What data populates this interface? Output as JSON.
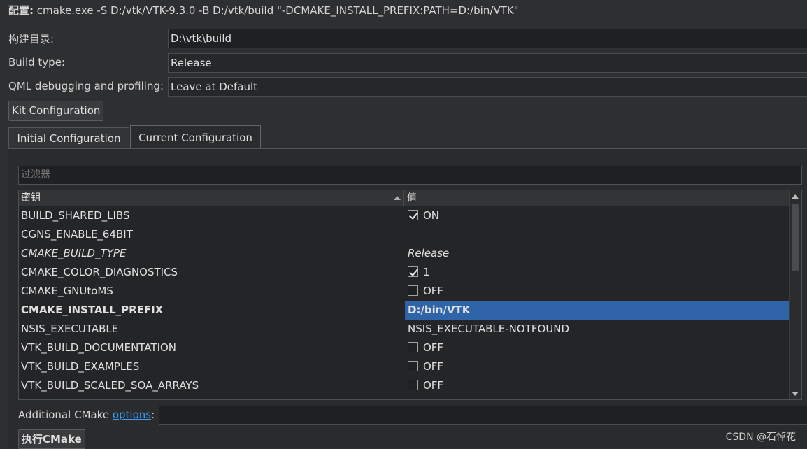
{
  "header": {
    "prefix": "配置:",
    "command": " cmake.exe -S D:/vtk/VTK-9.3.0 -B D:/vtk/build \"-DCMAKE_INSTALL_PREFIX:PATH=D:/bin/VTK\""
  },
  "form": {
    "build_dir_label": "构建目录:",
    "build_dir_value": "D:\\vtk\\build",
    "build_type_label": "Build type:",
    "build_type_value": "Release",
    "qml_label": "QML debugging and profiling:",
    "qml_value": "Leave at Default"
  },
  "kit_button": "Kit Configuration",
  "tabs": [
    {
      "label": "Initial Configuration",
      "active": false
    },
    {
      "label": "Current Configuration",
      "active": true
    }
  ],
  "filter_placeholder": "过滤器",
  "table": {
    "col_key": "密钥",
    "col_value": "值",
    "rows": [
      {
        "key": "BUILD_SHARED_LIBS",
        "value": "ON",
        "check": "on"
      },
      {
        "key": "CGNS_ENABLE_64BIT",
        "value": "",
        "check": ""
      },
      {
        "key": "CMAKE_BUILD_TYPE",
        "value": "Release",
        "check": "",
        "italic": true
      },
      {
        "key": "CMAKE_COLOR_DIAGNOSTICS",
        "value": "1",
        "check": "on"
      },
      {
        "key": "CMAKE_GNUtoMS",
        "value": "OFF",
        "check": "off"
      },
      {
        "key": "CMAKE_INSTALL_PREFIX",
        "value": "D:/bin/VTK",
        "check": "",
        "bold": true,
        "selected": true
      },
      {
        "key": "NSIS_EXECUTABLE",
        "value": "NSIS_EXECUTABLE-NOTFOUND",
        "check": ""
      },
      {
        "key": "VTK_BUILD_DOCUMENTATION",
        "value": "OFF",
        "check": "off"
      },
      {
        "key": "VTK_BUILD_EXAMPLES",
        "value": "OFF",
        "check": "off"
      },
      {
        "key": "VTK_BUILD_SCALED_SOA_ARRAYS",
        "value": "OFF",
        "check": "off"
      }
    ]
  },
  "additional": {
    "label": "Additional CMake ",
    "link": "options",
    "colon": ":",
    "value": ""
  },
  "run_button": "执行CMake",
  "watermark": "CSDN @石悼花",
  "colors": {
    "background": "#2e2f30",
    "selection": "#2f65a8",
    "link": "#3aa0ff"
  }
}
